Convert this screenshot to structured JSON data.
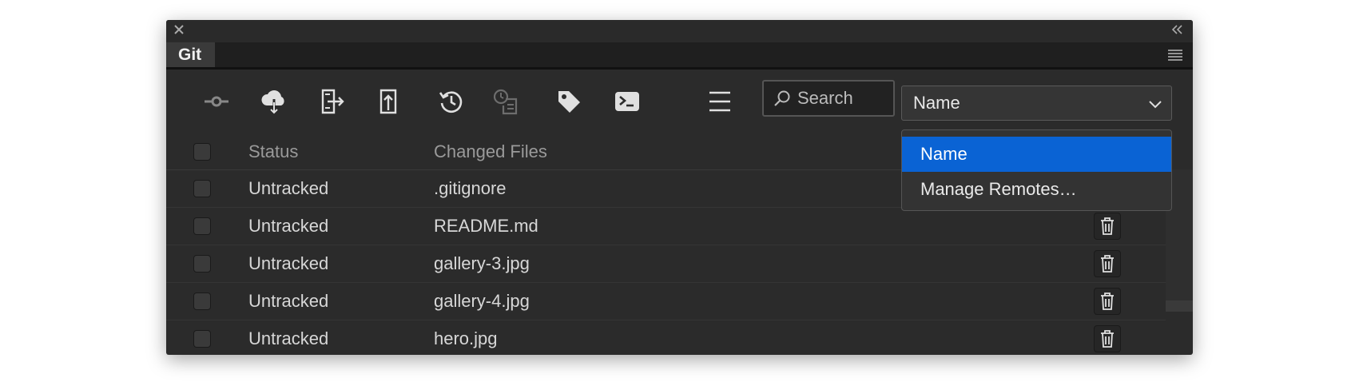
{
  "panel": {
    "tab_label": "Git"
  },
  "toolbar": {
    "icons": [
      "commit-icon",
      "pull-icon",
      "fetch-icon",
      "push-icon",
      "revert-icon",
      "history-icon",
      "tag-icon",
      "terminal-icon",
      "list-menu-icon"
    ],
    "search_placeholder": "Search",
    "sort_select_value": "Name"
  },
  "table": {
    "headers": {
      "status": "Status",
      "files": "Changed Files"
    },
    "rows": [
      {
        "status": "Untracked",
        "file": ".gitignore"
      },
      {
        "status": "Untracked",
        "file": "README.md"
      },
      {
        "status": "Untracked",
        "file": "gallery-3.jpg"
      },
      {
        "status": "Untracked",
        "file": "gallery-4.jpg"
      },
      {
        "status": "Untracked",
        "file": "hero.jpg"
      }
    ]
  },
  "dropdown": {
    "items": [
      {
        "label": "Name",
        "selected": true
      },
      {
        "label": "Manage Remotes…",
        "selected": false
      }
    ]
  },
  "colors": {
    "accent": "#0a63d4",
    "panel_bg": "#2b2b2b",
    "text": "#d7d7d7"
  }
}
